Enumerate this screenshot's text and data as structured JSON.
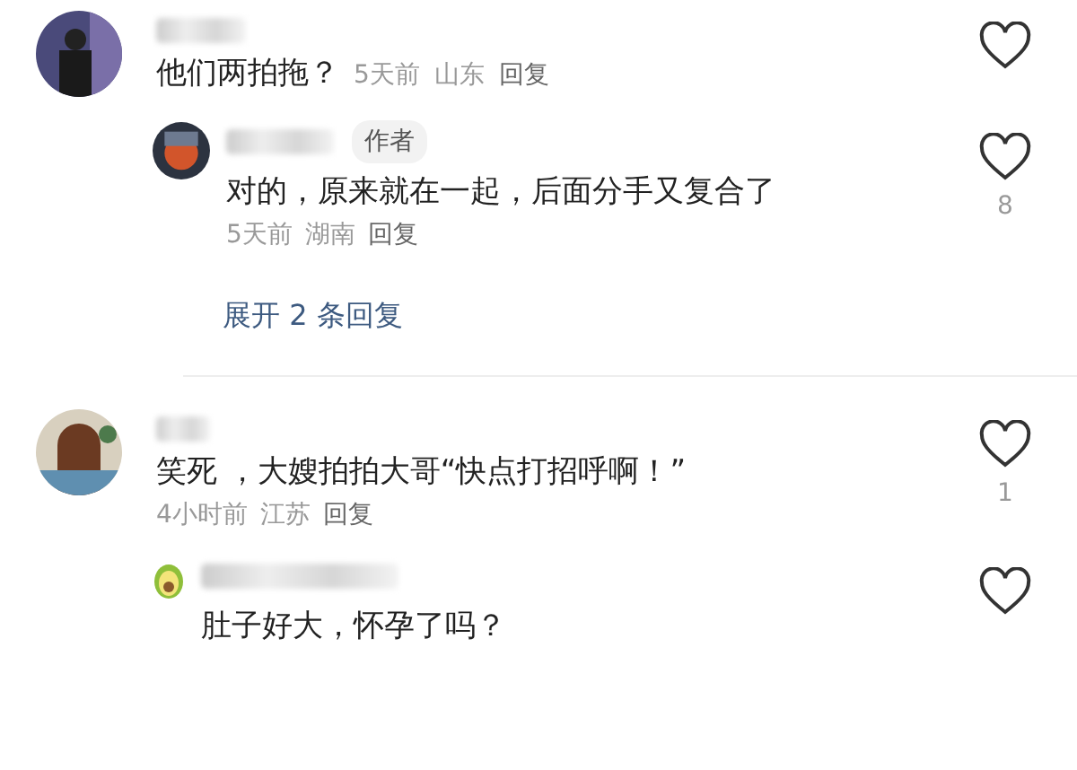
{
  "comments": [
    {
      "text": "他们两拍拖？",
      "time": "5天前",
      "location": "山东",
      "reply_label": "回复",
      "replies": [
        {
          "badge": "作者",
          "text": "对的，原来就在一起，后面分手又复合了",
          "time": "5天前",
          "location": "湖南",
          "reply_label": "回复",
          "likes": "8"
        }
      ],
      "expand_label": "展开 2 条回复"
    },
    {
      "text": "笑死 ，大嫂拍拍大哥“快点打招呼啊！”",
      "time": "4小时前",
      "location": "江苏",
      "reply_label": "回复",
      "likes": "1",
      "replies": [
        {
          "text": "肚子好大，怀孕了吗？"
        }
      ]
    }
  ]
}
